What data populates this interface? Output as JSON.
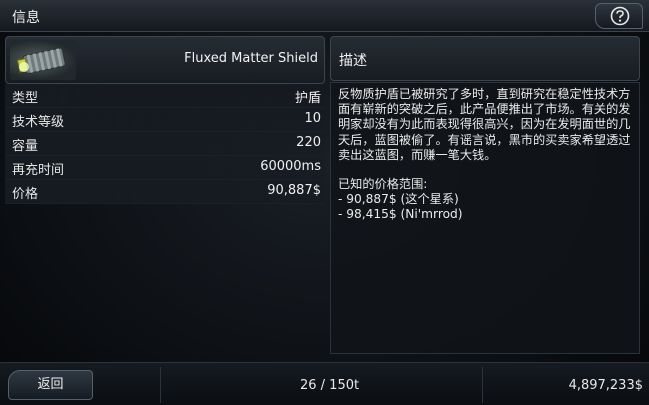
{
  "window": {
    "title": "信息"
  },
  "help": {
    "icon": "help-icon"
  },
  "item": {
    "name": "Fluxed Matter Shield",
    "icon": "shield-generator-icon"
  },
  "stats": [
    {
      "label": "类型",
      "value": "护盾"
    },
    {
      "label": "技术等级",
      "value": "10"
    },
    {
      "label": "容量",
      "value": "220"
    },
    {
      "label": "再充时间",
      "value": "60000ms"
    },
    {
      "label": "价格",
      "value": "90,887$"
    }
  ],
  "description": {
    "header": "描述",
    "text": "反物质护盾已被研究了多时，直到研究在稳定性技术方面有崭新的突破之后，此产品便推出了市场。有关的发明家却没有为此而表现得很高兴，因为在发明面世的几天后，蓝图被偷了。有谣言说，黑市的买卖家希望透过卖出这蓝图，而赚一笔大钱。",
    "prices_title": "已知的价格范围:",
    "prices": [
      "- 90,887$ (这个星系)",
      "- 98,415$ (Ni'mrrod)"
    ]
  },
  "footer": {
    "back_label": "返回",
    "cargo": "26 / 150t",
    "credits": "4,897,233$"
  }
}
